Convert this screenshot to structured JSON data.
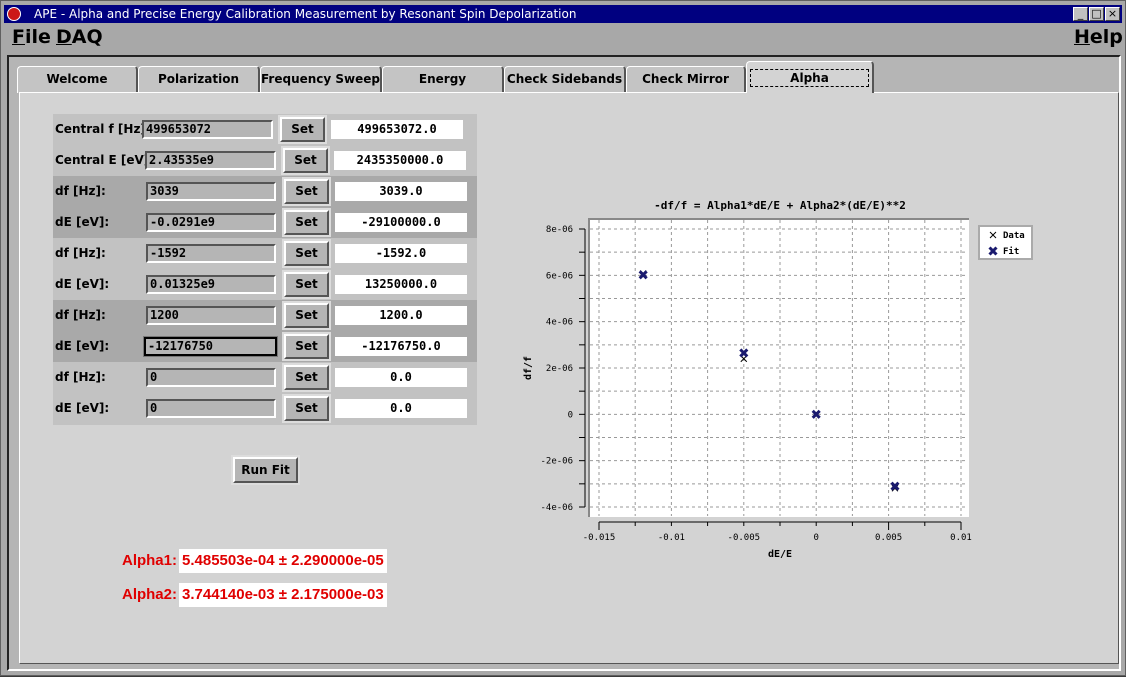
{
  "window": {
    "title": "APE - Alpha and Precise Energy Calibration Measurement by Resonant Spin Depolarization",
    "controls": {
      "minimize": "_",
      "maximize": "□",
      "close": "×"
    }
  },
  "menubar": {
    "items": [
      {
        "label": "File",
        "mnemonic": "F",
        "rest": "ile"
      },
      {
        "label": "DAQ",
        "mnemonic": "D",
        "rest": "AQ"
      }
    ],
    "help": {
      "label": "Help",
      "mnemonic": "H",
      "rest": "elp"
    }
  },
  "tabs": [
    {
      "label": "Welcome",
      "active": false
    },
    {
      "label": "Polarization Level",
      "active": false
    },
    {
      "label": "Frequency Sweep",
      "active": false
    },
    {
      "label": "Energy Calibration",
      "active": false
    },
    {
      "label": "Check Sidebands",
      "active": false
    },
    {
      "label": "Check Mirror",
      "active": false
    },
    {
      "label": "Alpha",
      "active": true
    }
  ],
  "form": {
    "set_label": "Set",
    "rows": [
      {
        "label": "Central f [Hz]:",
        "input": "499653072",
        "value": "499653072.0"
      },
      {
        "label": "Central E [eV]:",
        "input": "2.43535e9",
        "value": "2435350000.0"
      },
      {
        "label": "df [Hz]:",
        "input": "3039",
        "value": "3039.0"
      },
      {
        "label": "dE [eV]:",
        "input": "-0.0291e9",
        "value": "-29100000.0"
      },
      {
        "label": "df [Hz]:",
        "input": "-1592",
        "value": "-1592.0"
      },
      {
        "label": "dE [eV]:",
        "input": "0.01325e9",
        "value": "13250000.0"
      },
      {
        "label": "df [Hz]:",
        "input": "1200",
        "value": "1200.0"
      },
      {
        "label": "dE [eV]:",
        "input": "-12176750",
        "value": "-12176750.0"
      },
      {
        "label": "df [Hz]:",
        "input": "0",
        "value": "0.0"
      },
      {
        "label": "dE [eV]:",
        "input": "0",
        "value": "0.0"
      }
    ]
  },
  "run_fit_label": "Run Fit",
  "results": {
    "alpha1": {
      "label": "Alpha1:",
      "value": "5.485503e-04 ± 2.290000e-05"
    },
    "alpha2": {
      "label": "Alpha2:",
      "value": "3.744140e-03 ± 2.175000e-03"
    }
  },
  "colors": {
    "result_text": "#e00000",
    "fit_marker": "#1a1a6e",
    "data_marker": "#000000",
    "title_bar": "#000080"
  },
  "chart_data": {
    "type": "scatter",
    "title": "-df/f = Alpha1*dE/E + Alpha2*(dE/E)**2",
    "xlabel": "dE/E",
    "ylabel": "df/f",
    "xlim": [
      -0.0155,
      0.0105
    ],
    "ylim": [
      -4.4e-06,
      8.6e-06
    ],
    "xticks": [
      -0.015,
      -0.01,
      -0.005,
      0,
      0.005,
      0.01
    ],
    "xtick_labels": [
      "-0.015",
      "-0.01",
      "-0.005",
      "0",
      "0.005",
      "0.01"
    ],
    "yticks": [
      -4e-06,
      -2e-06,
      0,
      2e-06,
      4e-06,
      6e-06,
      8e-06
    ],
    "ytick_labels": [
      "-4e-06",
      "-2e-06",
      "0",
      "2e-06",
      "4e-06",
      "6e-06",
      "8e-06"
    ],
    "grid": true,
    "legend_position": "right",
    "series": [
      {
        "name": "Data",
        "marker": "x",
        "x": [
          -0.01195,
          -0.005,
          0.0,
          0.00544
        ],
        "y": [
          6.08e-06,
          2.4e-06,
          0.0,
          -3.19e-06
        ]
      },
      {
        "name": "Fit",
        "marker": "filled-x",
        "x": [
          -0.01195,
          -0.005,
          0.0,
          0.00544
        ],
        "y": [
          6.02e-06,
          2.65e-06,
          0.0,
          -3.1e-06
        ]
      }
    ]
  }
}
